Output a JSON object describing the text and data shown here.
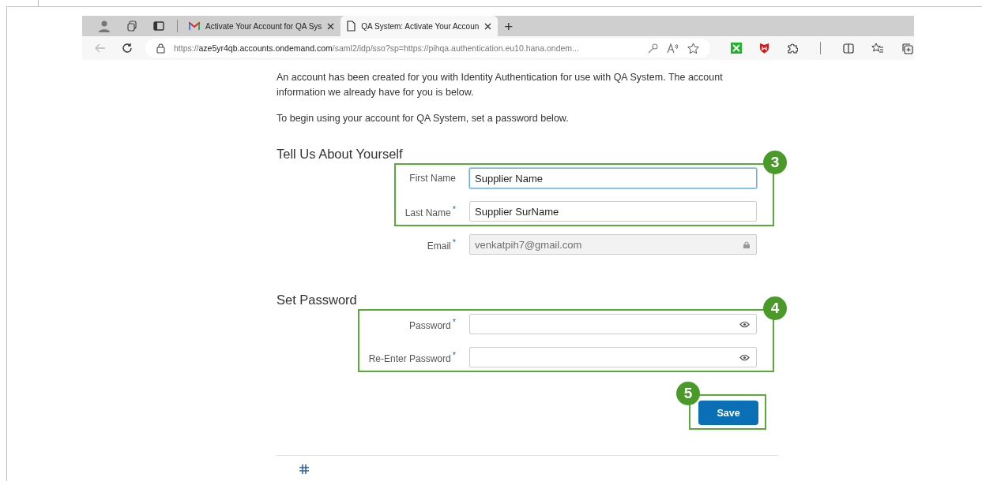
{
  "browser": {
    "tabs": [
      {
        "title": "Activate Your Account for QA Sys",
        "kind": "mail",
        "selected": false
      },
      {
        "title": "QA System: Activate Your Accoun",
        "kind": "page",
        "selected": true
      }
    ],
    "new_tab": "+",
    "address": {
      "scheme": "https://",
      "host": "aze5yr4qb.accounts.ondemand.com",
      "rest": "/saml2/idp/sso?sp=https://pihqa.authentication.eu10.hana.ondem..."
    }
  },
  "page": {
    "intro": [
      "An account has been created for you with Identity Authentication for use with QA System. The account information we already have for you is below.",
      "To begin using your account for QA System, set a password below."
    ],
    "sections": [
      {
        "title": "Tell Us About Yourself",
        "groups": [
          {
            "callout": "3",
            "fields": [
              {
                "label": "First Name",
                "value": "Supplier Name",
                "kind": "text",
                "focused": true,
                "disabled": false
              },
              {
                "label": "Last Name",
                "required_mark": "*",
                "value": "Supplier SurName",
                "kind": "text",
                "focused": false,
                "disabled": false
              }
            ]
          },
          {
            "fields": [
              {
                "label": "Email",
                "required_mark": "*",
                "value": "venkatpih7@gmail.com",
                "kind": "email",
                "focused": false,
                "disabled": true
              }
            ]
          }
        ]
      },
      {
        "title": "Set Password",
        "groups": [
          {
            "callout": "4",
            "fields": [
              {
                "label": "Password",
                "required_mark": "*",
                "kind": "password",
                "focused": false,
                "disabled": false
              },
              {
                "label": "Re-Enter Password",
                "required_mark": "*",
                "kind": "password",
                "focused": false,
                "disabled": false
              }
            ]
          }
        ]
      }
    ],
    "save": {
      "label": "Save",
      "callout": "5"
    }
  }
}
